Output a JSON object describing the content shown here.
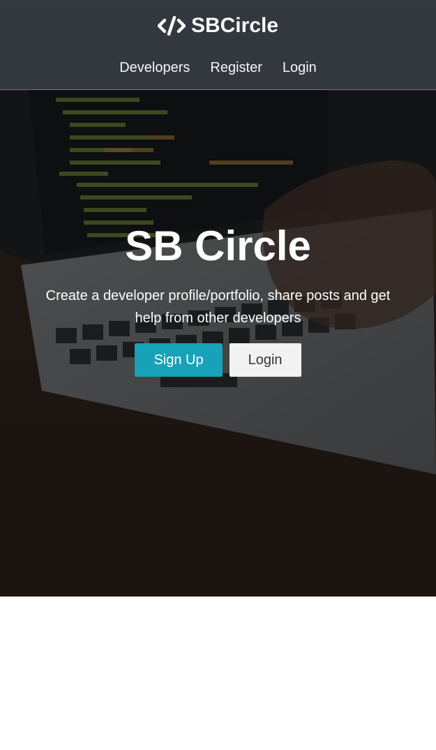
{
  "navbar": {
    "brand": "SBCircle",
    "brand_icon": "code-icon",
    "links": [
      "Developers",
      "Register",
      "Login"
    ],
    "accent_color": "#17a2b8",
    "background_color": "#343a40"
  },
  "hero": {
    "title": "SB Circle",
    "lead": "Create a developer profile/portfolio, share posts and get help from other developers",
    "buttons": {
      "signup": "Sign Up",
      "login": "Login"
    },
    "background_image": "laptop-code-photo"
  }
}
